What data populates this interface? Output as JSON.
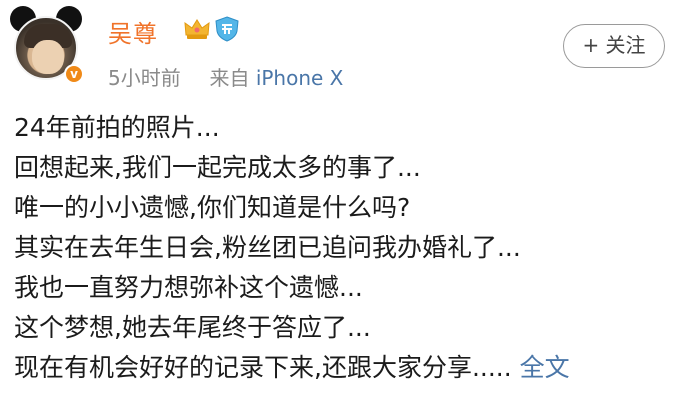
{
  "post": {
    "author": {
      "name": "吴尊",
      "avatar_icon": "avatar-mickey-ears",
      "verified_icon": "verified-badge-icon",
      "badges": [
        "crown-icon",
        "shield-badge-icon"
      ],
      "verified_mark": "v"
    },
    "meta": {
      "time": "5小时前",
      "source_prefix": "来自",
      "source": "iPhone X"
    },
    "follow_label": "+ 关注",
    "lines": [
      "24年前拍的照片...",
      "回想起来,我们一起完成太多的事了...",
      "唯一的小小遗憾,你们知道是什么吗?",
      "其实在去年生日会,粉丝团已追问我办婚礼了...",
      "我也一直努力想弥补这个遗憾...",
      "这个梦想,她去年尾终于答应了...",
      "现在有机会好好的记录下来,还跟大家分享....."
    ],
    "expand_label": "全文",
    "colors": {
      "username": "#f0732a",
      "link": "#4a76a8",
      "meta": "#8a8a8a",
      "text": "#1b1b1b"
    }
  }
}
